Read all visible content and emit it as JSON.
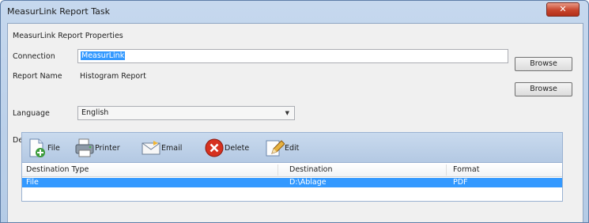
{
  "window": {
    "title": "MeasurLink Report Task",
    "close_glyph": "✕"
  },
  "properties": {
    "group_label": "MeasurLink Report Properties",
    "connection_label": "Connection",
    "connection_value": "MeasurLink",
    "connection_browse": "Browse",
    "report_name_label": "Report Name",
    "report_name_value": "Histogram Report",
    "report_browse": "Browse",
    "language_label": "Language",
    "language_value": "English"
  },
  "destinations": {
    "label": "Destinations",
    "toolbar": {
      "file": "File",
      "printer": "Printer",
      "email": "Email",
      "delete": "Delete",
      "edit": "Edit"
    },
    "columns": [
      "Destination Type",
      "Destination",
      "Format"
    ],
    "rows": [
      {
        "type": "File",
        "destination": "D:\\Ablage",
        "format": "PDF"
      }
    ]
  }
}
